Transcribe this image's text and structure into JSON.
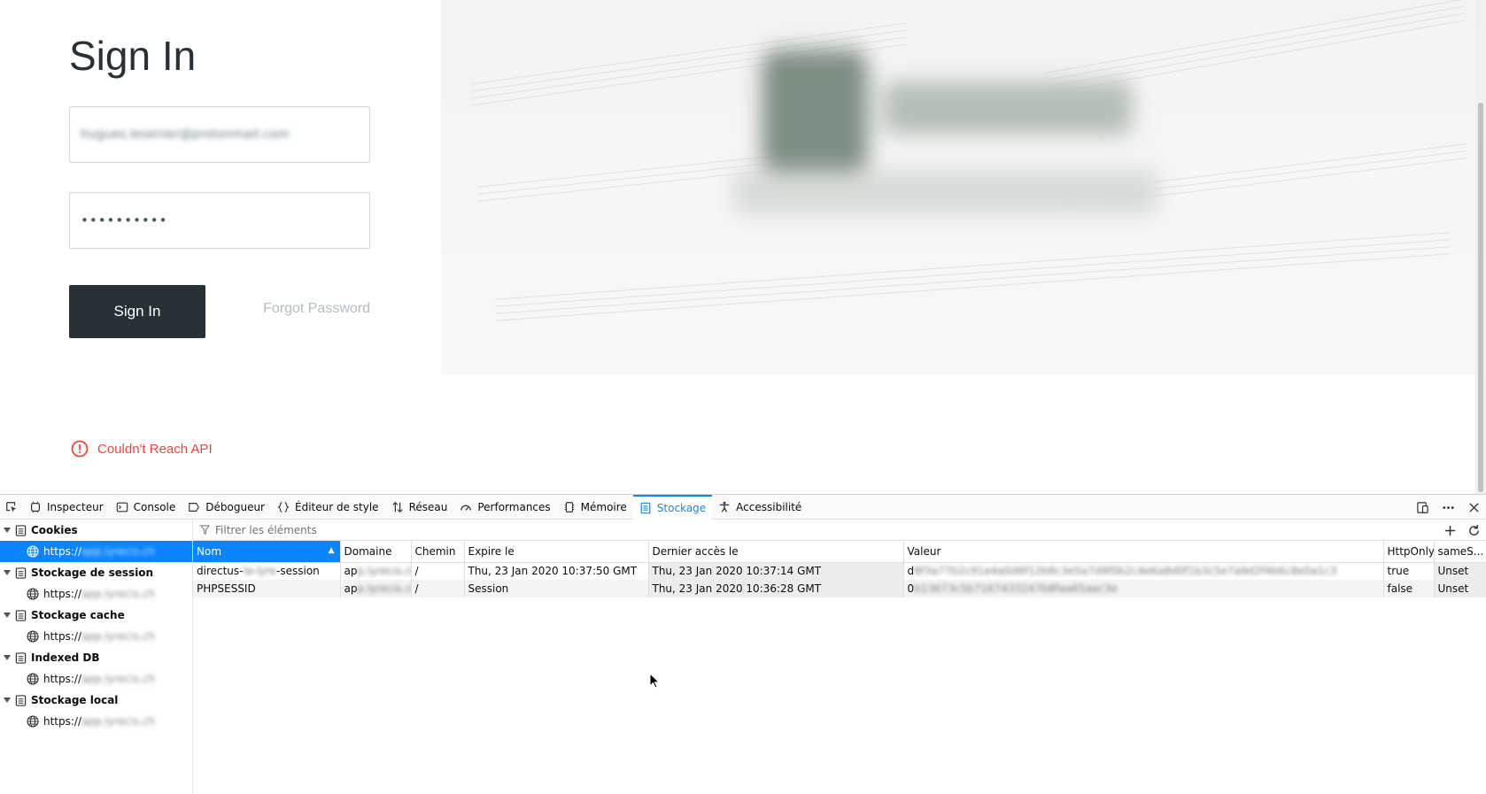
{
  "login": {
    "title": "Sign In",
    "email_value": "hugues.lesenier@protonmail.com",
    "password_value": "••••••••••",
    "sign_in_label": "Sign In",
    "forgot_label": "Forgot Password",
    "error_text": "Couldn't Reach API"
  },
  "devtools": {
    "tabs": [
      {
        "label": "Inspecteur",
        "icon": "inspector-icon"
      },
      {
        "label": "Console",
        "icon": "console-icon"
      },
      {
        "label": "Débogueur",
        "icon": "debugger-icon"
      },
      {
        "label": "Éditeur de style",
        "icon": "style-editor-icon"
      },
      {
        "label": "Réseau",
        "icon": "network-icon"
      },
      {
        "label": "Performances",
        "icon": "performance-icon"
      },
      {
        "label": "Mémoire",
        "icon": "memory-icon"
      },
      {
        "label": "Stockage",
        "icon": "storage-icon"
      },
      {
        "label": "Accessibilité",
        "icon": "accessibility-icon"
      }
    ],
    "active_tab": "Stockage",
    "tree": [
      {
        "group": "Cookies",
        "item_prefix": "https://",
        "item_host": "app.lyrecis.ch",
        "selected": true
      },
      {
        "group": "Stockage de session",
        "item_prefix": "https://",
        "item_host": "app.lyrecis.ch",
        "selected": false
      },
      {
        "group": "Stockage cache",
        "item_prefix": "https://",
        "item_host": "app.lyrecis.ch",
        "selected": false
      },
      {
        "group": "Indexed DB",
        "item_prefix": "https://",
        "item_host": "app.lyrecis.ch",
        "selected": false
      },
      {
        "group": "Stockage local",
        "item_prefix": "https://",
        "item_host": "app.lyrecis.ch",
        "selected": false
      }
    ],
    "filter_placeholder": "Filtrer les éléments",
    "columns": [
      "Nom",
      "Domaine",
      "Chemin",
      "Expire le",
      "Dernier accès le",
      "Valeur",
      "HttpOnly",
      "sameS..."
    ],
    "rows": [
      {
        "name_prefix": "directus-",
        "name_blur": "la-lyre",
        "name_suffix": "-session",
        "domain_prefix": "ap",
        "domain_blur": "p.lyrecis.ch",
        "path": "/",
        "expires": "Thu, 23 Jan 2020 10:37:50 GMT",
        "last_access": "Thu, 23 Jan 2020 10:37:14 GMT",
        "value_prefix": "d",
        "value_blur": "8f3a77b2c91e4a0d6f12b8c3e5a7d9f0b2c4e6a8d0f1b3c5e7a9d2f4b6c8e0a1c3",
        "httponly": "true",
        "samesite": "Unset"
      },
      {
        "name_prefix": "PHPSESSID",
        "name_blur": "",
        "name_suffix": "",
        "domain_prefix": "ap",
        "domain_blur": "p.lyrecis.ch",
        "path": "/",
        "expires": "Session",
        "last_access": "Thu, 23 Jan 2020 10:36:28 GMT",
        "value_prefix": "0",
        "value_blur": "b13673c5b7167433247b8faa65aac3e",
        "httponly": "false",
        "samesite": "Unset"
      }
    ]
  }
}
